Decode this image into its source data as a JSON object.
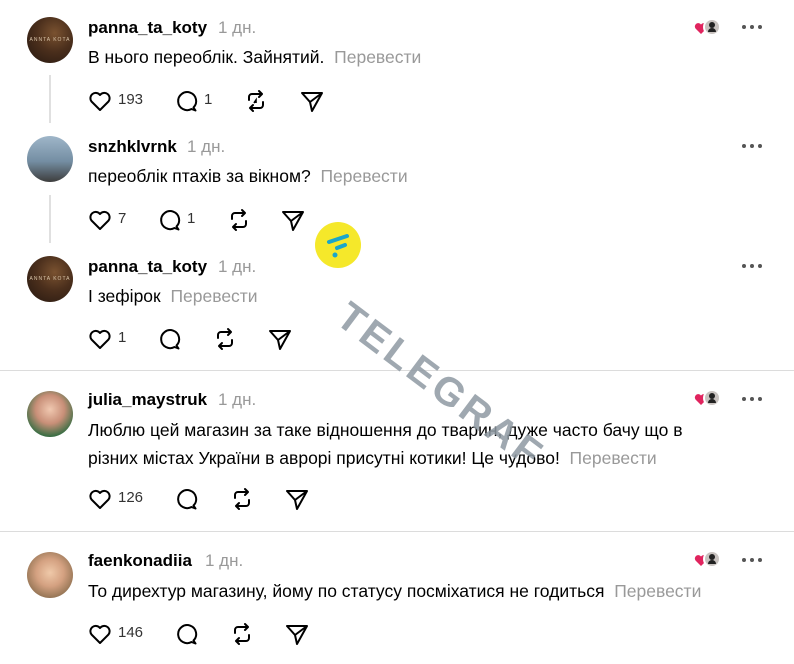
{
  "posts": [
    {
      "username": "panna_ta_koty",
      "time": "1 дн.",
      "text": "В нього переоблік. Зайнятий.",
      "translate": "Перевести",
      "likes": "193",
      "comments": "1",
      "reposts": "",
      "shares": "",
      "avatar_text": "ANNTA KOTA"
    },
    {
      "username": "snzhklvrnk",
      "time": "1 дн.",
      "text": "переоблік птахів за вікном?",
      "translate": "Перевести",
      "likes": "7",
      "comments": "1"
    },
    {
      "username": "panna_ta_koty",
      "time": "1 дн.",
      "text": "І зефірок",
      "translate": "Перевести",
      "likes": "1",
      "comments": "",
      "avatar_text": "ANNTA KOTA"
    },
    {
      "username": "julia_maystruk",
      "time": "1 дн.",
      "line1": "Люблю цей магазин за таке відношення до тварин, дуже часто бачу що в",
      "line2": "різних містах України в аврорі присутні котики! Це чудово!",
      "translate": "Перевести",
      "likes": "126"
    },
    {
      "username": "faenkonadiia",
      "time": "1 дн.",
      "text": "То дирехтур магазину, йому по статусу посміхатися не годиться",
      "translate": "Перевести",
      "likes": "146"
    }
  ],
  "watermark": {
    "text": "TELEGRAF",
    "circle_color": "#f5e82a"
  },
  "colors": {
    "heart": "#e0245e",
    "muted": "#999999"
  },
  "icons": [
    "heart-icon",
    "comment-icon",
    "repost-icon",
    "share-icon",
    "more-icon"
  ]
}
